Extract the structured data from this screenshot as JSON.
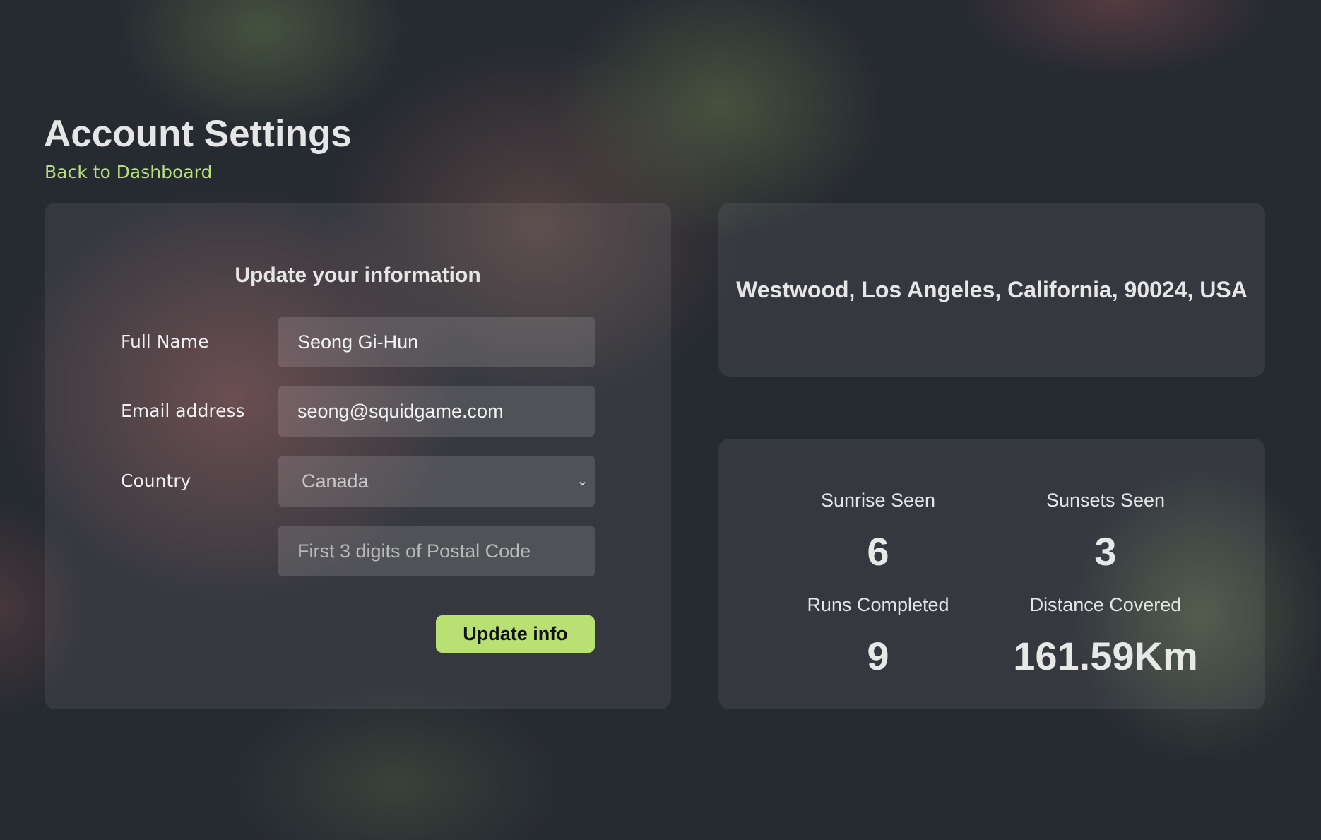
{
  "page": {
    "title": "Account Settings",
    "back_link": "Back to Dashboard"
  },
  "form": {
    "heading": "Update your information",
    "full_name": {
      "label": "Full Name",
      "value": "Seong Gi-Hun"
    },
    "email": {
      "label": "Email address",
      "value": "seong@squidgame.com"
    },
    "country": {
      "label": "Country",
      "selected": "Canada"
    },
    "postal_code": {
      "placeholder": "First 3 digits of Postal Code",
      "value": ""
    },
    "submit_label": "Update info"
  },
  "location": {
    "address": "Westwood, Los Angeles, California, 90024, USA"
  },
  "stats": {
    "sunrise": {
      "label": "Sunrise Seen",
      "value": "6"
    },
    "sunsets": {
      "label": "Sunsets Seen",
      "value": "3"
    },
    "runs": {
      "label": "Runs Completed",
      "value": "9"
    },
    "distance": {
      "label": "Distance Covered",
      "value": "161.59Km"
    }
  },
  "colors": {
    "accent": "#b8e073",
    "link": "#b8e07a",
    "background": "#262a31"
  },
  "icons": {
    "country_dropdown": "chevron-down-icon"
  }
}
